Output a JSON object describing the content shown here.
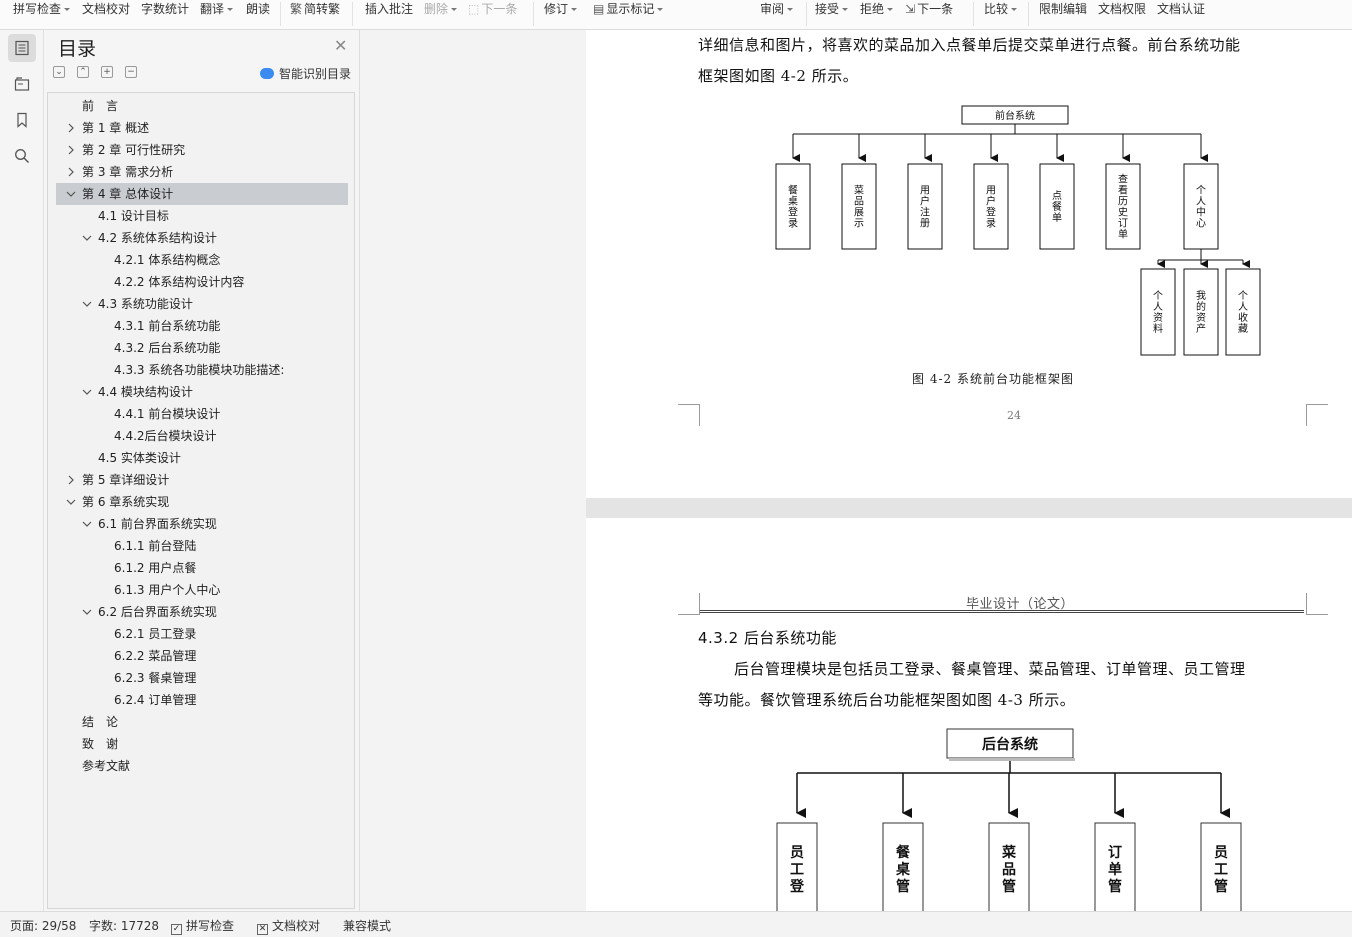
{
  "toolbar": {
    "spell_check": "拼写检查",
    "doc_proof": "文档校对",
    "word_count": "字数统计",
    "translate": "翻译",
    "read_aloud": "朗读",
    "simp_trad": "简转繁",
    "insert_comment": "插入批注",
    "delete": "删除",
    "next_item": "下一条",
    "revise": "修订",
    "show_marks": "显示标记",
    "review": "审阅",
    "accept": "接受",
    "reject": "拒绝",
    "next_change": "下一条",
    "compare": "比较",
    "restrict_edit": "限制编辑",
    "doc_permission": "文档权限",
    "doc_certify": "文档认证"
  },
  "toc": {
    "title": "目录",
    "smart_label": "智能识别目录",
    "items": [
      {
        "label": "前　言",
        "level": 1,
        "chevron": "none"
      },
      {
        "label": "第 1 章  概述",
        "level": 1,
        "chevron": "right"
      },
      {
        "label": "第 2 章  可行性研究",
        "level": 1,
        "chevron": "right"
      },
      {
        "label": "第 3 章  需求分析",
        "level": 1,
        "chevron": "right"
      },
      {
        "label": "第 4 章  总体设计",
        "level": 1,
        "chevron": "down",
        "selected": true
      },
      {
        "label": "4.1  设计目标",
        "level": 2,
        "chevron": "none"
      },
      {
        "label": "4.2  系统体系结构设计",
        "level": 2,
        "chevron": "down"
      },
      {
        "label": "4.2.1  体系结构概念",
        "level": 3,
        "chevron": "none"
      },
      {
        "label": "4.2.2  体系结构设计内容",
        "level": 3,
        "chevron": "none"
      },
      {
        "label": "4.3  系统功能设计",
        "level": 2,
        "chevron": "down"
      },
      {
        "label": "4.3.1  前台系统功能",
        "level": 3,
        "chevron": "none"
      },
      {
        "label": "4.3.2  后台系统功能",
        "level": 3,
        "chevron": "none"
      },
      {
        "label": "4.3.3  系统各功能模块功能描述:",
        "level": 3,
        "chevron": "none"
      },
      {
        "label": "4.4  模块结构设计",
        "level": 2,
        "chevron": "down"
      },
      {
        "label": "4.4.1  前台模块设计",
        "level": 3,
        "chevron": "none"
      },
      {
        "label": "4.4.2后台模块设计",
        "level": 3,
        "chevron": "none"
      },
      {
        "label": "4.5  实体类设计",
        "level": 2,
        "chevron": "none"
      },
      {
        "label": "第 5 章详细设计",
        "level": 1,
        "chevron": "right"
      },
      {
        "label": "第 6 章系统实现",
        "level": 1,
        "chevron": "down"
      },
      {
        "label": "6.1  前台界面系统实现",
        "level": 2,
        "chevron": "down"
      },
      {
        "label": "6.1.1  前台登陆",
        "level": 3,
        "chevron": "none"
      },
      {
        "label": "6.1.2  用户点餐",
        "level": 3,
        "chevron": "none"
      },
      {
        "label": "6.1.3  用户个人中心",
        "level": 3,
        "chevron": "none"
      },
      {
        "label": "6.2  后台界面系统实现",
        "level": 2,
        "chevron": "down"
      },
      {
        "label": "6.2.1  员工登录",
        "level": 3,
        "chevron": "none"
      },
      {
        "label": "6.2.2  菜品管理",
        "level": 3,
        "chevron": "none"
      },
      {
        "label": "6.2.3  餐桌管理",
        "level": 3,
        "chevron": "none"
      },
      {
        "label": "6.2.4  订单管理",
        "level": 3,
        "chevron": "none"
      },
      {
        "label": "结　论",
        "level": 1,
        "chevron": "none"
      },
      {
        "label": "致　谢",
        "level": 1,
        "chevron": "none"
      },
      {
        "label": "参考文献",
        "level": 1,
        "chevron": "none"
      }
    ]
  },
  "page1": {
    "line1": "详细信息和图片，将喜欢的菜品加入点餐单后提交菜单进行点餐。前台系统功能",
    "line2": "框架图如图 4-2 所示。",
    "diagram": {
      "root": "前台系统",
      "children": [
        "餐桌登录",
        "菜品展示",
        "用户注册",
        "用户登录",
        "点餐单",
        "查看历史订单",
        "个人中心"
      ],
      "sub_children": [
        "个人资料",
        "我的资产",
        "个人收藏"
      ]
    },
    "caption": "图 4-2  系统前台功能框架图",
    "page_number": "24"
  },
  "page2": {
    "header": "毕业设计（论文）",
    "heading": "4.3.2  后台系统功能",
    "line1": "后台管理模块是包括员工登录、餐桌管理、菜品管理、订单管理、员工管理",
    "line2": "等功能。餐饮管理系统后台功能框架图如图 4-3 所示。",
    "diagram": {
      "root": "后台系统",
      "children_visible": [
        "员工登",
        "餐桌管",
        "菜品管",
        "订单管",
        "员工管"
      ]
    }
  },
  "status": {
    "page": "页面: 29/58",
    "words": "字数: 17728",
    "spell_check": "拼写检查",
    "doc_proof": "文档校对",
    "compat": "兼容模式"
  }
}
